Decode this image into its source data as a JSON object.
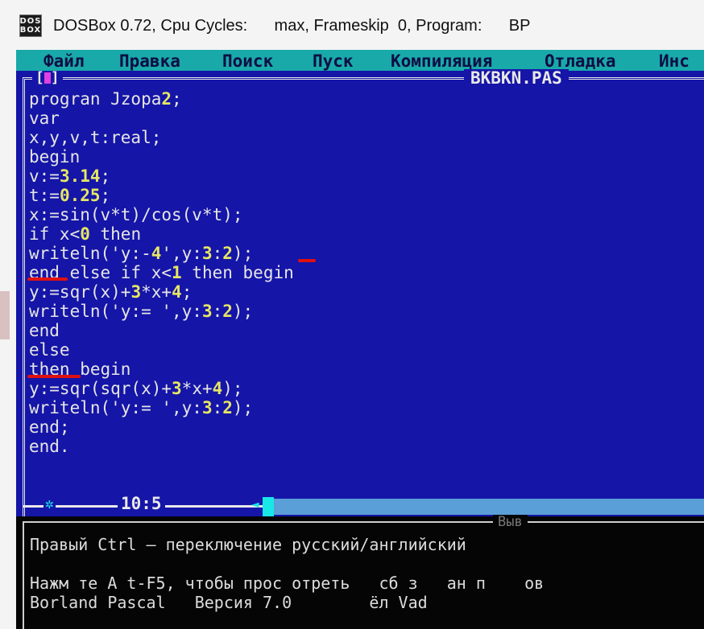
{
  "window": {
    "icon_text": [
      "DOS",
      "BOX"
    ],
    "title": "DOSBox 0.72, Cpu Cycles:      max, Frameskip  0, Program:      BP"
  },
  "menu": {
    "items": [
      "Файл",
      "Правка",
      "Поиск",
      "Пуск",
      "Компиляция",
      "Отладка",
      "Инс"
    ]
  },
  "editor": {
    "close_box": "[▪]",
    "filename": "BKBKN.PAS",
    "lines": [
      "progran Jzopa2;",
      "var",
      "x,y,v,t:real;",
      "begin",
      "v:=3.14;",
      "t:=0.25;",
      "x:=sin(v*t)/cos(v*t);",
      "if x<0 then",
      "writeln('y:-4',y:3:2);",
      "end else if x<1 then begin",
      "y:=sqr(x)+3*x+4;",
      "writeln('y:= ',y:3:2);",
      "end",
      "else",
      "then begin",
      "y:=sqr(sqr(x)+3*x+4);",
      "writeln('y:= ',y:3:2);",
      "end;",
      "end."
    ],
    "cursor_position": "10:5",
    "colors": {
      "background": "#1515a8",
      "menu": "#19a9a9",
      "text": "#e6e6e6",
      "number": "#e6e664",
      "annotation": "#e01010"
    }
  },
  "output": {
    "title": "Выв",
    "lines": [
      "Правый Ctrl — переключение русский/английский",
      "Нажм те А t-F5, чтобы прос отреть   сб з   ан п    ов",
      "Borland Pascal   Версия 7.0        ёл Vad"
    ]
  }
}
